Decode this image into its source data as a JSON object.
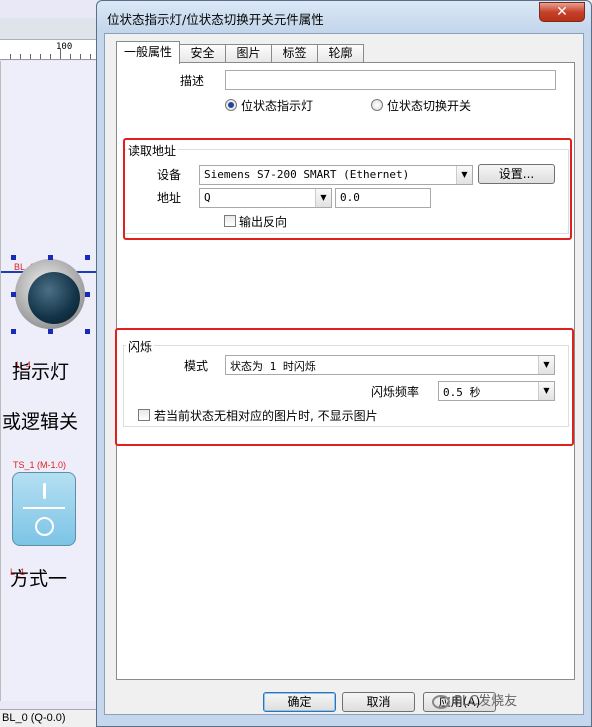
{
  "background_editor": {
    "ruler_number": "100",
    "lamp_tag": "BL_0 (Q-0.0)",
    "lamp_caption": "指示灯",
    "mid_caption": "或逻辑关",
    "switch_tag": "TS_1 (M-1.0)",
    "switch_caption": "方式一",
    "small_red_tag_1": "L_4",
    "small_red_tag_2": "L_1",
    "statusbar_text": "BL_0 (Q-0.0)"
  },
  "dialog": {
    "title": "位状态指示灯/位状态切换开关元件属性",
    "close_label": "✕",
    "tabs": [
      {
        "label": "一般属性",
        "active": true
      },
      {
        "label": "安全"
      },
      {
        "label": "图片"
      },
      {
        "label": "标签"
      },
      {
        "label": "轮廓"
      }
    ],
    "description_label": "描述",
    "description_value": "",
    "radio_indicator_label": "位状态指示灯",
    "radio_switch_label": "位状态切换开关",
    "read_address": {
      "group_title": "读取地址",
      "device_label": "设备",
      "device_value": "Siemens S7-200 SMART (Ethernet)",
      "settings_button": "设置...",
      "address_label": "地址",
      "address_type": "Q",
      "address_value": "0.0",
      "invert_output_label": "输出反向"
    },
    "blink": {
      "group_title": "闪烁",
      "mode_label": "模式",
      "mode_value": "状态为 1 时闪烁",
      "frequency_label": "闪烁频率",
      "frequency_value": "0.5 秒",
      "no_image_label": "若当前状态无相对应的图片时, 不显示图片"
    },
    "buttons": {
      "ok": "确定",
      "cancel": "取消",
      "apply": "应用(A)"
    },
    "watermark": "PLC发烧友"
  },
  "colors": {
    "highlight_red": "#e0201c",
    "titlebar": "#c4d7ec",
    "close_red": "#c7412a"
  }
}
